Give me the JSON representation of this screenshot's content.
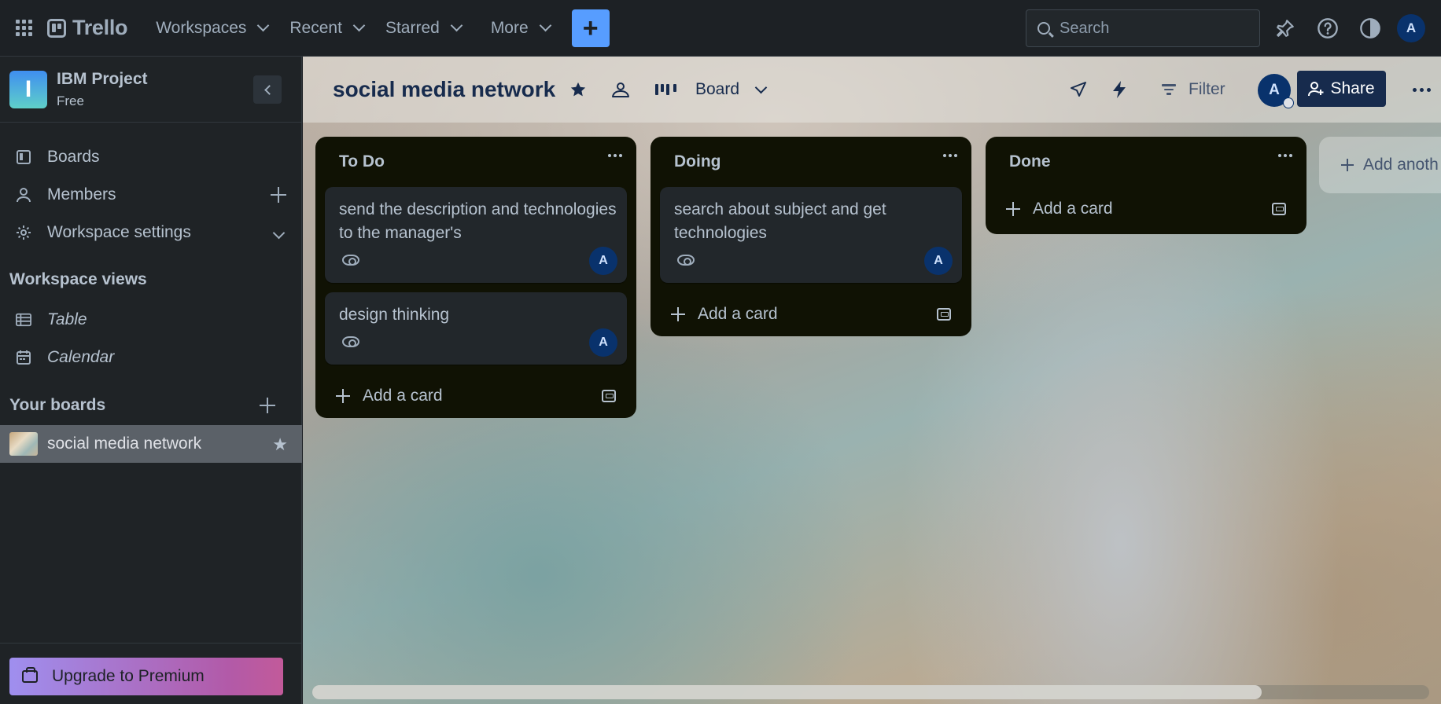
{
  "topbar": {
    "logo_text": "Trello",
    "nav": [
      {
        "label": "Workspaces"
      },
      {
        "label": "Recent"
      },
      {
        "label": "Starred"
      },
      {
        "label": "More"
      }
    ],
    "create_label": "+",
    "search_placeholder": "Search",
    "user_initial": "A",
    "icons": [
      "apps-grid-icon",
      "notification-icon",
      "help-icon",
      "theme-icon"
    ]
  },
  "sidebar": {
    "workspace": {
      "initial": "I",
      "name": "IBM Project",
      "plan": "Free"
    },
    "items": [
      {
        "label": "Boards"
      },
      {
        "label": "Members"
      },
      {
        "label": "Workspace settings"
      }
    ],
    "views_title": "Workspace views",
    "views": [
      {
        "label": "Table"
      },
      {
        "label": "Calendar"
      }
    ],
    "boards_title": "Your boards",
    "boards": [
      {
        "label": "social media network",
        "starred": true
      }
    ],
    "upgrade_label": "Upgrade to Premium"
  },
  "board": {
    "title": "social media network",
    "view_label": "Board",
    "filter_label": "Filter",
    "member_initial": "A",
    "share_label": "Share",
    "add_list_label": "Add anoth",
    "scroll_fraction": 0.85
  },
  "lists": [
    {
      "name": "To Do",
      "cards": [
        {
          "title": "send the description and technologies to the manager's",
          "member": "A"
        },
        {
          "title": "design thinking",
          "member": "A"
        }
      ],
      "add_card_label": "Add a card"
    },
    {
      "name": "Doing",
      "cards": [
        {
          "title": "search about subject and get technologies",
          "member": "A"
        }
      ],
      "add_card_label": "Add a card"
    },
    {
      "name": "Done",
      "cards": [],
      "add_card_label": "Add a card"
    }
  ],
  "colors": {
    "topbar_bg": "#1d2125",
    "create_accent": "#579dff",
    "list_bg": "#101204",
    "card_bg": "#22272b",
    "share_bg": "#172b4d",
    "avatar_bg": "#09326c"
  }
}
